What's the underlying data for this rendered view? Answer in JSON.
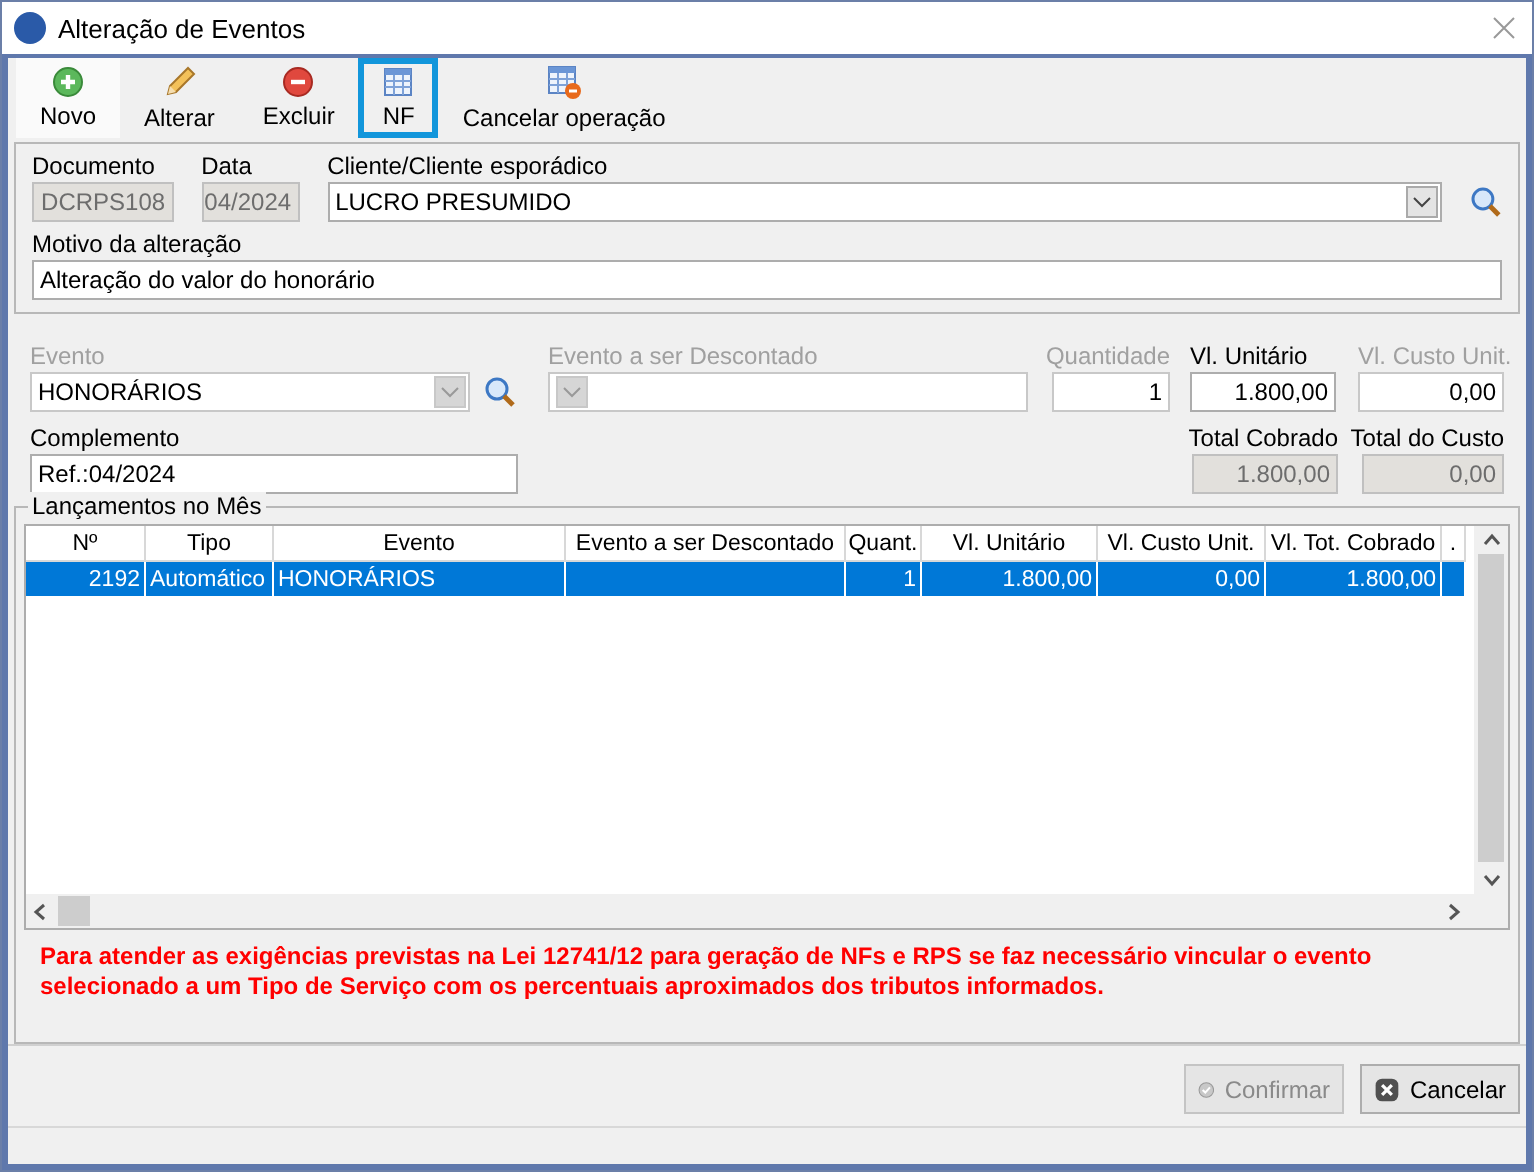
{
  "window": {
    "title": "Alteração de Eventos"
  },
  "toolbar": [
    {
      "label": "Novo",
      "selected": false
    },
    {
      "label": "Alterar",
      "selected": false
    },
    {
      "label": "Excluir",
      "selected": false
    },
    {
      "label": "NF",
      "selected": true
    },
    {
      "label": "Cancelar operação",
      "selected": false
    }
  ],
  "header": {
    "documento": {
      "label": "Documento",
      "value": "DCRPS108",
      "readonly": true
    },
    "data": {
      "label": "Data",
      "value": "04/2024",
      "readonly": true
    },
    "cliente": {
      "label": "Cliente/Cliente esporádico",
      "value": "LUCRO PRESUMIDO"
    },
    "motivo": {
      "label": "Motivo da alteração",
      "value": "Alteração do valor do honorário"
    }
  },
  "evento_panel": {
    "evento": {
      "label": "Evento",
      "value": "HONORÁRIOS",
      "disabled": true
    },
    "evento_descontado": {
      "label": "Evento a ser Descontado",
      "disabled": true
    },
    "quantidade": {
      "label": "Quantidade",
      "value": "1",
      "disabled": true
    },
    "vl_unitario": {
      "label": "Vl. Unitário",
      "value": "1.800,00",
      "disabled": false
    },
    "vl_custo_unit": {
      "label": "Vl. Custo Unit.",
      "value": "0,00",
      "disabled": true
    },
    "complemento": {
      "label": "Complemento",
      "value": "Ref.:04/2024",
      "disabled": false
    },
    "total_cobrado": {
      "label": "Total Cobrado",
      "value": "1.800,00",
      "readonly": true
    },
    "total_custo": {
      "label": "Total do Custo",
      "value": "0,00",
      "readonly": true
    }
  },
  "table": {
    "title": "Lançamentos no Mês",
    "columns": [
      "Nº",
      "Tipo",
      "Evento",
      "Evento a ser Descontado",
      "Quant.",
      "Vl. Unitário",
      "Vl. Custo Unit.",
      "Vl. Tot. Cobrado",
      "."
    ],
    "rows": [
      {
        "cells": [
          "2192",
          "Automático",
          "HONORÁRIOS",
          "",
          "1",
          "1.800,00",
          "0,00",
          "1.800,00"
        ],
        "selected": true
      }
    ]
  },
  "warning": "Para atender as exigências previstas na Lei 12741/12 para geração de NFs e RPS se faz necessário vincular o evento selecionado a um Tipo de Serviço com os percentuais aproximados dos tributos informados.",
  "buttons": [
    {
      "label": "Confirmar",
      "disabled": true
    },
    {
      "label": "Cancelar",
      "disabled": false
    }
  ]
}
